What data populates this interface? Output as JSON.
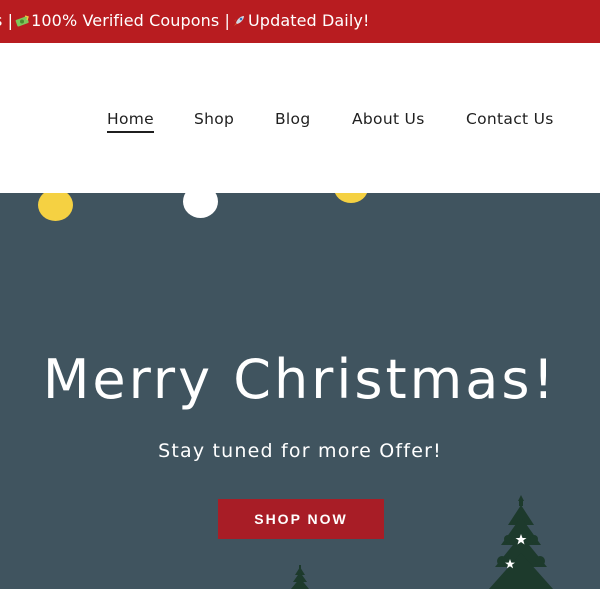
{
  "announcement": {
    "segments": [
      {
        "text": "s |"
      },
      {
        "icon": "money-icon",
        "text": "100% Verified Coupons |"
      },
      {
        "icon": "rocket-icon",
        "text": "Updated Daily!"
      }
    ]
  },
  "nav": {
    "items": [
      "Home",
      "Shop",
      "Blog",
      "About Us",
      "Contact Us"
    ],
    "active": "Home"
  },
  "hero": {
    "title": "Merry Christmas!",
    "subtitle": "Stay tuned for more Offer!",
    "button_label": "SHOP NOW"
  },
  "colors": {
    "announcement_bg": "#b81c20",
    "hero_bg": "#40545f",
    "button_bg": "#a81d26",
    "bulb_yellow": "#f5d142",
    "bulb_white": "#ffffff",
    "tree_green": "#1d3a2c"
  }
}
